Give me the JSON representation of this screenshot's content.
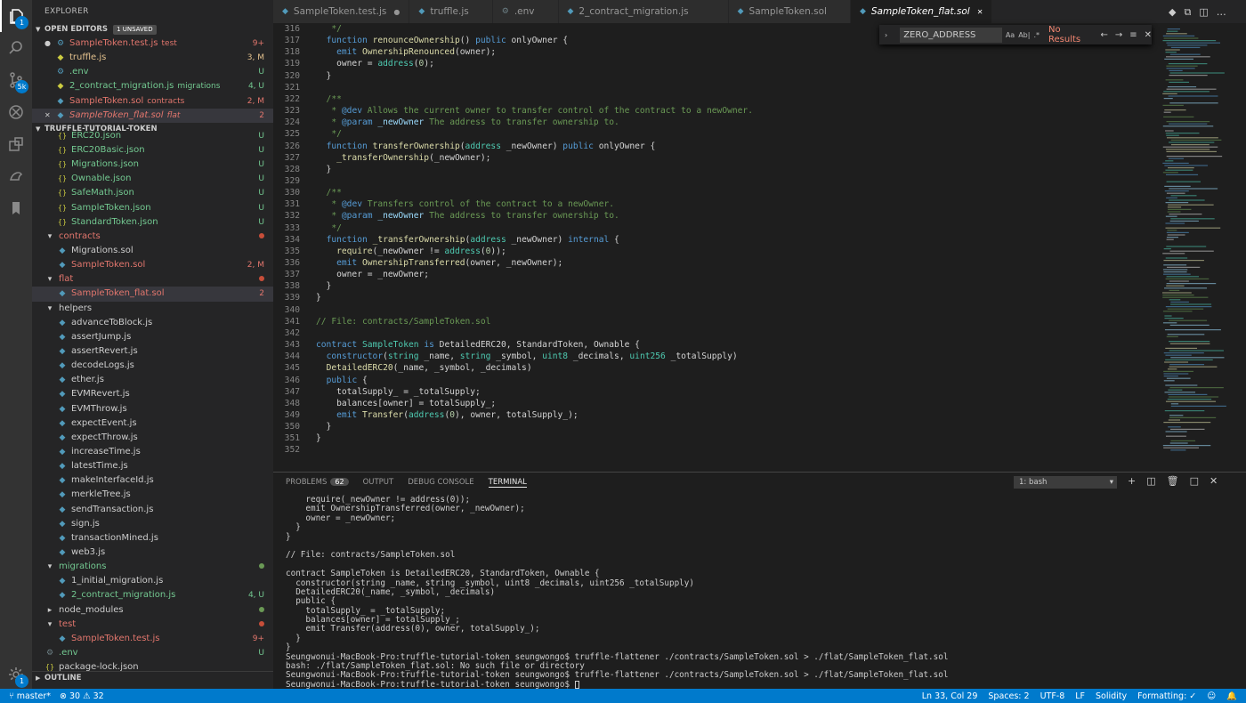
{
  "activity": {
    "scm_badge": "5k",
    "settings_badge": "1"
  },
  "sidebar": {
    "title": "EXPLORER",
    "open_editors_label": "OPEN EDITORS",
    "unsaved_badge": "1 UNSAVED",
    "open_editors": [
      {
        "name": "SampleToken.test.js",
        "desc": "test",
        "status": "9+",
        "color": "r",
        "icon": "gear-icon",
        "dirty": true
      },
      {
        "name": "truffle.js",
        "desc": "",
        "status": "3, M",
        "color": "o",
        "icon": "js-icon"
      },
      {
        "name": ".env",
        "desc": "",
        "status": "U",
        "color": "g",
        "icon": "gear-icon"
      },
      {
        "name": "2_contract_migration.js",
        "desc": "migrations",
        "status": "4, U",
        "color": "g",
        "icon": "js-icon"
      },
      {
        "name": "SampleToken.sol",
        "desc": "contracts",
        "status": "2, M",
        "color": "r",
        "icon": "sol-icon"
      },
      {
        "name": "SampleToken_flat.sol",
        "desc": "flat",
        "status": "2",
        "color": "r",
        "icon": "sol-icon",
        "selected": true
      }
    ],
    "project_label": "TRUFFLE-TUTORIAL-TOKEN",
    "tree": [
      {
        "name": "ERC20.json",
        "status": "U",
        "color": "g",
        "indent": 2,
        "icon": "{}"
      },
      {
        "name": "ERC20Basic.json",
        "status": "U",
        "color": "g",
        "indent": 2,
        "icon": "{}"
      },
      {
        "name": "Migrations.json",
        "status": "U",
        "color": "g",
        "indent": 2,
        "icon": "{}"
      },
      {
        "name": "Ownable.json",
        "status": "U",
        "color": "g",
        "indent": 2,
        "icon": "{}"
      },
      {
        "name": "SafeMath.json",
        "status": "U",
        "color": "g",
        "indent": 2,
        "icon": "{}"
      },
      {
        "name": "SampleToken.json",
        "status": "U",
        "color": "g",
        "indent": 2,
        "icon": "{}"
      },
      {
        "name": "StandardToken.json",
        "status": "U",
        "color": "g",
        "indent": 2,
        "icon": "{}"
      },
      {
        "name": "contracts",
        "status": "dot",
        "color": "r",
        "indent": 1,
        "folder": true
      },
      {
        "name": "Migrations.sol",
        "status": "",
        "color": "w",
        "indent": 2,
        "icon": "sol"
      },
      {
        "name": "SampleToken.sol",
        "status": "2, M",
        "color": "r",
        "indent": 2,
        "icon": "sol"
      },
      {
        "name": "flat",
        "status": "dot",
        "color": "r",
        "indent": 1,
        "folder": true
      },
      {
        "name": "SampleToken_flat.sol",
        "status": "2",
        "color": "r",
        "indent": 2,
        "icon": "sol",
        "selected": true
      },
      {
        "name": "helpers",
        "status": "",
        "color": "w",
        "indent": 1,
        "folder": true
      },
      {
        "name": "advanceToBlock.js",
        "status": "",
        "color": "w",
        "indent": 2,
        "icon": "js"
      },
      {
        "name": "assertJump.js",
        "status": "",
        "color": "w",
        "indent": 2,
        "icon": "js"
      },
      {
        "name": "assertRevert.js",
        "status": "",
        "color": "w",
        "indent": 2,
        "icon": "js"
      },
      {
        "name": "decodeLogs.js",
        "status": "",
        "color": "w",
        "indent": 2,
        "icon": "js"
      },
      {
        "name": "ether.js",
        "status": "",
        "color": "w",
        "indent": 2,
        "icon": "js"
      },
      {
        "name": "EVMRevert.js",
        "status": "",
        "color": "w",
        "indent": 2,
        "icon": "js"
      },
      {
        "name": "EVMThrow.js",
        "status": "",
        "color": "w",
        "indent": 2,
        "icon": "js"
      },
      {
        "name": "expectEvent.js",
        "status": "",
        "color": "w",
        "indent": 2,
        "icon": "js"
      },
      {
        "name": "expectThrow.js",
        "status": "",
        "color": "w",
        "indent": 2,
        "icon": "js"
      },
      {
        "name": "increaseTime.js",
        "status": "",
        "color": "w",
        "indent": 2,
        "icon": "js"
      },
      {
        "name": "latestTime.js",
        "status": "",
        "color": "w",
        "indent": 2,
        "icon": "js"
      },
      {
        "name": "makeInterfaceId.js",
        "status": "",
        "color": "w",
        "indent": 2,
        "icon": "js"
      },
      {
        "name": "merkleTree.js",
        "status": "",
        "color": "w",
        "indent": 2,
        "icon": "js"
      },
      {
        "name": "sendTransaction.js",
        "status": "",
        "color": "w",
        "indent": 2,
        "icon": "js"
      },
      {
        "name": "sign.js",
        "status": "",
        "color": "w",
        "indent": 2,
        "icon": "js"
      },
      {
        "name": "transactionMined.js",
        "status": "",
        "color": "w",
        "indent": 2,
        "icon": "js"
      },
      {
        "name": "web3.js",
        "status": "",
        "color": "w",
        "indent": 2,
        "icon": "js"
      },
      {
        "name": "migrations",
        "status": "dotg",
        "color": "g",
        "indent": 1,
        "folder": true
      },
      {
        "name": "1_initial_migration.js",
        "status": "",
        "color": "w",
        "indent": 2,
        "icon": "js"
      },
      {
        "name": "2_contract_migration.js",
        "status": "4, U",
        "color": "g",
        "indent": 2,
        "icon": "js"
      },
      {
        "name": "node_modules",
        "status": "dotg",
        "color": "w",
        "indent": 1,
        "folder": true,
        "collapsed": true
      },
      {
        "name": "test",
        "status": "dot",
        "color": "r",
        "indent": 1,
        "folder": true
      },
      {
        "name": "SampleToken.test.js",
        "status": "9+",
        "color": "r",
        "indent": 2,
        "icon": "js"
      },
      {
        "name": ".env",
        "status": "U",
        "color": "g",
        "indent": 1,
        "icon": "gear"
      },
      {
        "name": "package-lock.json",
        "status": "",
        "color": "w",
        "indent": 1,
        "icon": "{}"
      }
    ],
    "outline_label": "OUTLINE"
  },
  "tabs": [
    {
      "label": "SampleToken.test.js",
      "dirty": true
    },
    {
      "label": "truffle.js"
    },
    {
      "label": ".env"
    },
    {
      "label": "2_contract_migration.js"
    },
    {
      "label": "SampleToken.sol"
    },
    {
      "label": "SampleToken_flat.sol",
      "active": true
    }
  ],
  "find": {
    "value": "ZERO_ADDRESS",
    "result": "No Results",
    "case": "Aa",
    "word": "Ab|",
    "regex": ".*"
  },
  "code": [
    {
      "n": "316",
      "t": "   */",
      "c": "cm"
    },
    {
      "n": "317",
      "h": [
        [
          "  ",
          ""
        ],
        [
          "function",
          "kw"
        ],
        [
          " ",
          ""
        ],
        [
          "renounceOwnership",
          "fn"
        ],
        [
          "() ",
          ""
        ],
        [
          "public",
          "kw"
        ],
        [
          " onlyOwner {",
          ""
        ]
      ]
    },
    {
      "n": "318",
      "h": [
        [
          "    ",
          ""
        ],
        [
          "emit",
          "kw"
        ],
        [
          " ",
          ""
        ],
        [
          "OwnershipRenounced",
          "fn"
        ],
        [
          "(owner);",
          ""
        ]
      ]
    },
    {
      "n": "319",
      "h": [
        [
          "    owner = ",
          ""
        ],
        [
          "address",
          "ty"
        ],
        [
          "(",
          ""
        ],
        [
          "0",
          "nu"
        ],
        [
          ");",
          ""
        ]
      ]
    },
    {
      "n": "320",
      "t": "  }"
    },
    {
      "n": "321",
      "t": ""
    },
    {
      "n": "322",
      "t": "  /**",
      "c": "cm"
    },
    {
      "n": "323",
      "h": [
        [
          "   * ",
          "cm"
        ],
        [
          "@dev",
          "ct"
        ],
        [
          " Allows the current owner to transfer control of the contract to a newOwner.",
          "cm"
        ]
      ]
    },
    {
      "n": "324",
      "h": [
        [
          "   * ",
          "cm"
        ],
        [
          "@param",
          "ct"
        ],
        [
          " _newOwner",
          "pr"
        ],
        [
          " The address to transfer ownership to.",
          "cm"
        ]
      ]
    },
    {
      "n": "325",
      "t": "   */",
      "c": "cm"
    },
    {
      "n": "326",
      "h": [
        [
          "  ",
          ""
        ],
        [
          "function",
          "kw"
        ],
        [
          " ",
          ""
        ],
        [
          "transferOwnership",
          "fn"
        ],
        [
          "(",
          ""
        ],
        [
          "address",
          "ty"
        ],
        [
          " _newOwner) ",
          ""
        ],
        [
          "public",
          "kw"
        ],
        [
          " onlyOwner {",
          ""
        ]
      ]
    },
    {
      "n": "327",
      "h": [
        [
          "    ",
          ""
        ],
        [
          "_transferOwnership",
          "fn"
        ],
        [
          "(_newOwner);",
          ""
        ]
      ]
    },
    {
      "n": "328",
      "t": "  }"
    },
    {
      "n": "329",
      "t": ""
    },
    {
      "n": "330",
      "t": "  /**",
      "c": "cm"
    },
    {
      "n": "331",
      "h": [
        [
          "   * ",
          "cm"
        ],
        [
          "@dev",
          "ct"
        ],
        [
          " Transfers control of the contract to a newOwner.",
          "cm"
        ]
      ]
    },
    {
      "n": "332",
      "h": [
        [
          "   * ",
          "cm"
        ],
        [
          "@param",
          "ct"
        ],
        [
          " _newOwner",
          "pr"
        ],
        [
          " The address to transfer ownership to.",
          "cm"
        ]
      ]
    },
    {
      "n": "333",
      "t": "   */",
      "c": "cm"
    },
    {
      "n": "334",
      "h": [
        [
          "  ",
          ""
        ],
        [
          "function",
          "kw"
        ],
        [
          " ",
          ""
        ],
        [
          "_transferOwnership",
          "fn"
        ],
        [
          "(",
          ""
        ],
        [
          "address",
          "ty"
        ],
        [
          " _newOwner) ",
          ""
        ],
        [
          "internal",
          "kw"
        ],
        [
          " {",
          ""
        ]
      ]
    },
    {
      "n": "335",
      "h": [
        [
          "    ",
          ""
        ],
        [
          "require",
          "fn"
        ],
        [
          "(_newOwner != ",
          ""
        ],
        [
          "address",
          "ty"
        ],
        [
          "(",
          ""
        ],
        [
          "0",
          "nu"
        ],
        [
          "));",
          ""
        ]
      ]
    },
    {
      "n": "336",
      "h": [
        [
          "    ",
          ""
        ],
        [
          "emit",
          "kw"
        ],
        [
          " ",
          ""
        ],
        [
          "OwnershipTransferred",
          "fn"
        ],
        [
          "(owner, _newOwner);",
          ""
        ]
      ]
    },
    {
      "n": "337",
      "t": "    owner = _newOwner;"
    },
    {
      "n": "338",
      "t": "  }"
    },
    {
      "n": "339",
      "t": "}"
    },
    {
      "n": "340",
      "t": ""
    },
    {
      "n": "341",
      "t": "// File: contracts/SampleToken.sol",
      "c": "cm"
    },
    {
      "n": "342",
      "t": ""
    },
    {
      "n": "343",
      "h": [
        [
          "contract",
          "kw"
        ],
        [
          " ",
          ""
        ],
        [
          "SampleToken",
          "ty"
        ],
        [
          " ",
          ""
        ],
        [
          "is",
          "kw"
        ],
        [
          " DetailedERC20, StandardToken, Ownable {",
          ""
        ]
      ]
    },
    {
      "n": "344",
      "h": [
        [
          "  ",
          ""
        ],
        [
          "constructor",
          "kw"
        ],
        [
          "(",
          ""
        ],
        [
          "string",
          "ty"
        ],
        [
          " _name, ",
          ""
        ],
        [
          "string",
          "ty"
        ],
        [
          " _symbol, ",
          ""
        ],
        [
          "uint8",
          "ty"
        ],
        [
          " _decimals, ",
          ""
        ],
        [
          "uint256",
          "ty"
        ],
        [
          " _totalSupply)",
          ""
        ]
      ]
    },
    {
      "n": "345",
      "h": [
        [
          "  ",
          ""
        ],
        [
          "DetailedERC20",
          "fn"
        ],
        [
          "(_name, _symbol, _decimals)",
          ""
        ]
      ]
    },
    {
      "n": "346",
      "h": [
        [
          "  ",
          ""
        ],
        [
          "public",
          "kw"
        ],
        [
          " {",
          ""
        ]
      ]
    },
    {
      "n": "347",
      "t": "    totalSupply_ = _totalSupply;"
    },
    {
      "n": "348",
      "t": "    balances[owner] = totalSupply_;"
    },
    {
      "n": "349",
      "h": [
        [
          "    ",
          ""
        ],
        [
          "emit",
          "kw"
        ],
        [
          " ",
          ""
        ],
        [
          "Transfer",
          "fn"
        ],
        [
          "(",
          ""
        ],
        [
          "address",
          "ty"
        ],
        [
          "(",
          ""
        ],
        [
          "0",
          "nu"
        ],
        [
          "), owner, totalSupply_);",
          ""
        ]
      ]
    },
    {
      "n": "350",
      "t": "  }"
    },
    {
      "n": "351",
      "t": "}"
    },
    {
      "n": "352",
      "t": ""
    }
  ],
  "panel": {
    "tabs": [
      {
        "label": "PROBLEMS",
        "count": "62"
      },
      {
        "label": "OUTPUT"
      },
      {
        "label": "DEBUG CONSOLE"
      },
      {
        "label": "TERMINAL",
        "active": true
      }
    ],
    "terminal_select": "1: bash",
    "lines": [
      "    require(_newOwner != address(0));",
      "    emit OwnershipTransferred(owner, _newOwner);",
      "    owner = _newOwner;",
      "  }",
      "}",
      "",
      "// File: contracts/SampleToken.sol",
      "",
      "contract SampleToken is DetailedERC20, StandardToken, Ownable {",
      "  constructor(string _name, string _symbol, uint8 _decimals, uint256 _totalSupply)",
      "  DetailedERC20(_name, _symbol, _decimals)",
      "  public {",
      "    totalSupply_ = _totalSupply;",
      "    balances[owner] = totalSupply_;",
      "    emit Transfer(address(0), owner, totalSupply_);",
      "  }",
      "}",
      "Seungwonui-MacBook-Pro:truffle-tutorial-token seungwongo$ truffle-flattener ./contracts/SampleToken.sol > ./flat/SampleToken_flat.sol",
      "bash: ./flat/SampleToken_flat.sol: No such file or directory",
      "Seungwonui-MacBook-Pro:truffle-tutorial-token seungwongo$ truffle-flattener ./contracts/SampleToken.sol > ./flat/SampleToken_flat.sol",
      "Seungwonui-MacBook-Pro:truffle-tutorial-token seungwongo$ "
    ]
  },
  "status": {
    "branch": "master*",
    "errors": "30",
    "warnings": "32",
    "position": "Ln 33, Col 29",
    "spaces": "Spaces: 2",
    "encoding": "UTF-8",
    "eol": "LF",
    "language": "Solidity",
    "formatting": "Formatting: ✓"
  },
  "colors": {
    "accent": "#007acc",
    "bg": "#1e1e1e",
    "sidebar": "#252526"
  }
}
